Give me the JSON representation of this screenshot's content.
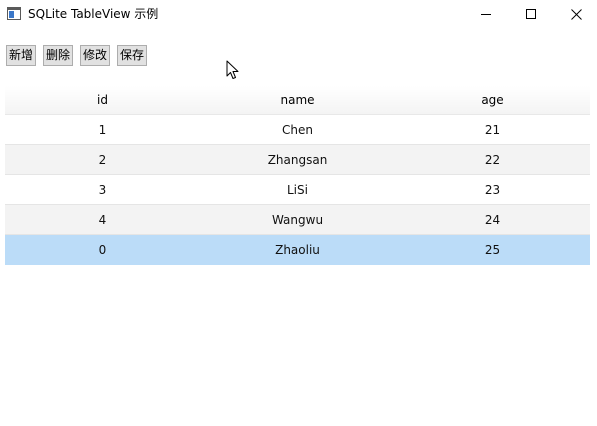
{
  "window": {
    "title": "SQLite TableView 示例",
    "icon": "window-app-icon",
    "controls": [
      "minimize-icon",
      "maximize-icon",
      "close-icon"
    ]
  },
  "toolbar": {
    "add_label": "新增",
    "delete_label": "删除",
    "edit_label": "修改",
    "save_label": "保存"
  },
  "table": {
    "columns": [
      "id",
      "name",
      "age"
    ],
    "rows": [
      {
        "id": "1",
        "name": "Chen",
        "age": "21"
      },
      {
        "id": "2",
        "name": "Zhangsan",
        "age": "22"
      },
      {
        "id": "3",
        "name": "LiSi",
        "age": "23"
      },
      {
        "id": "4",
        "name": "Wangwu",
        "age": "24"
      },
      {
        "id": "0",
        "name": "Zhaoliu",
        "age": "25"
      }
    ],
    "selected_row_index": 4,
    "selection_color": "#bbdcf8",
    "alternate_row_color": "#f3f3f3"
  }
}
